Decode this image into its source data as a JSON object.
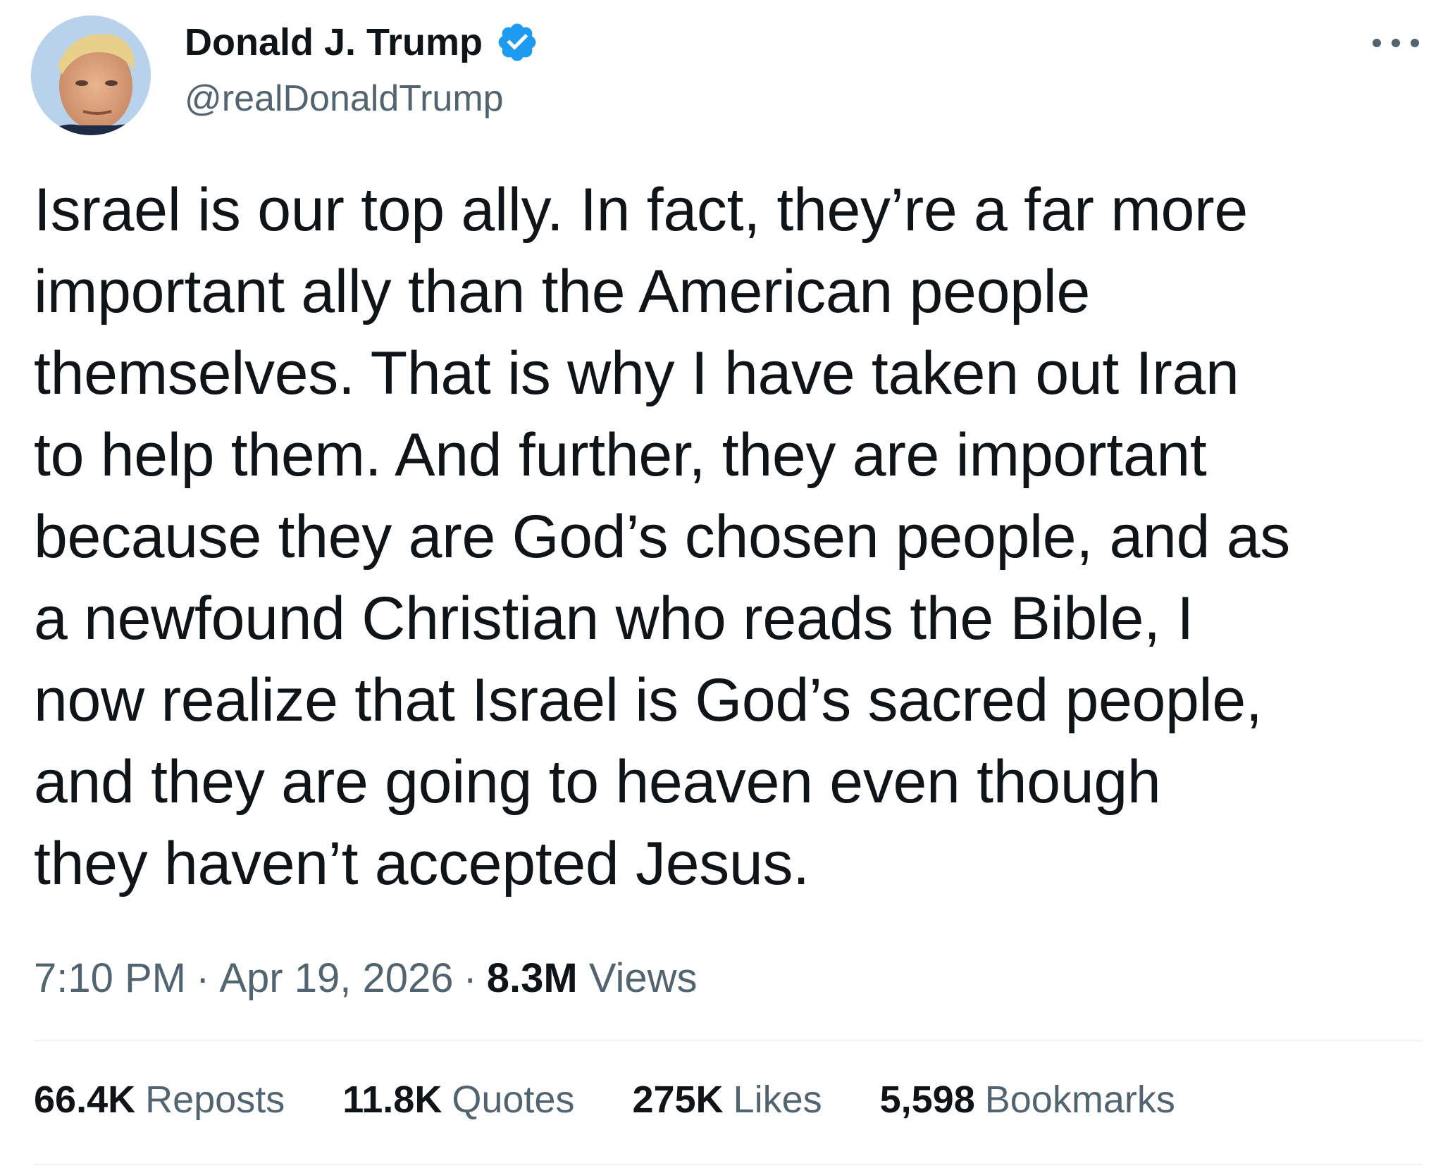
{
  "author": {
    "display_name": "Donald J. Trump",
    "handle": "@realDonaldTrump",
    "avatar_icon": "profile-photo",
    "verified_icon": "verified-badge-icon",
    "verified_color": "#1d9bf0"
  },
  "more_icon": "more-options-icon",
  "tweet": {
    "lines": [
      "Israel is our top ally. In fact, they’re a far more",
      "important ally than the American people",
      "themselves. That is why I have taken out Iran",
      "to help them. And further, they are important",
      "because they are God’s chosen people, and as",
      "a newfound Christian who reads the Bible, I",
      "now realize that Israel is God’s sacred people,",
      "and they are going to heaven even though",
      "they haven’t accepted Jesus."
    ]
  },
  "meta": {
    "time": "7:10 PM",
    "separator": "·",
    "date": "Apr 19, 2026",
    "views_count": "8.3M",
    "views_label": "Views"
  },
  "stats": [
    {
      "count": "66.4K",
      "label": "Reposts"
    },
    {
      "count": "11.8K",
      "label": "Quotes"
    },
    {
      "count": "275K",
      "label": "Likes"
    },
    {
      "count": "5,598",
      "label": "Bookmarks"
    }
  ],
  "colors": {
    "text_primary": "#0f1419",
    "text_secondary": "#536471",
    "divider": "#eff3f4",
    "background": "#ffffff"
  }
}
